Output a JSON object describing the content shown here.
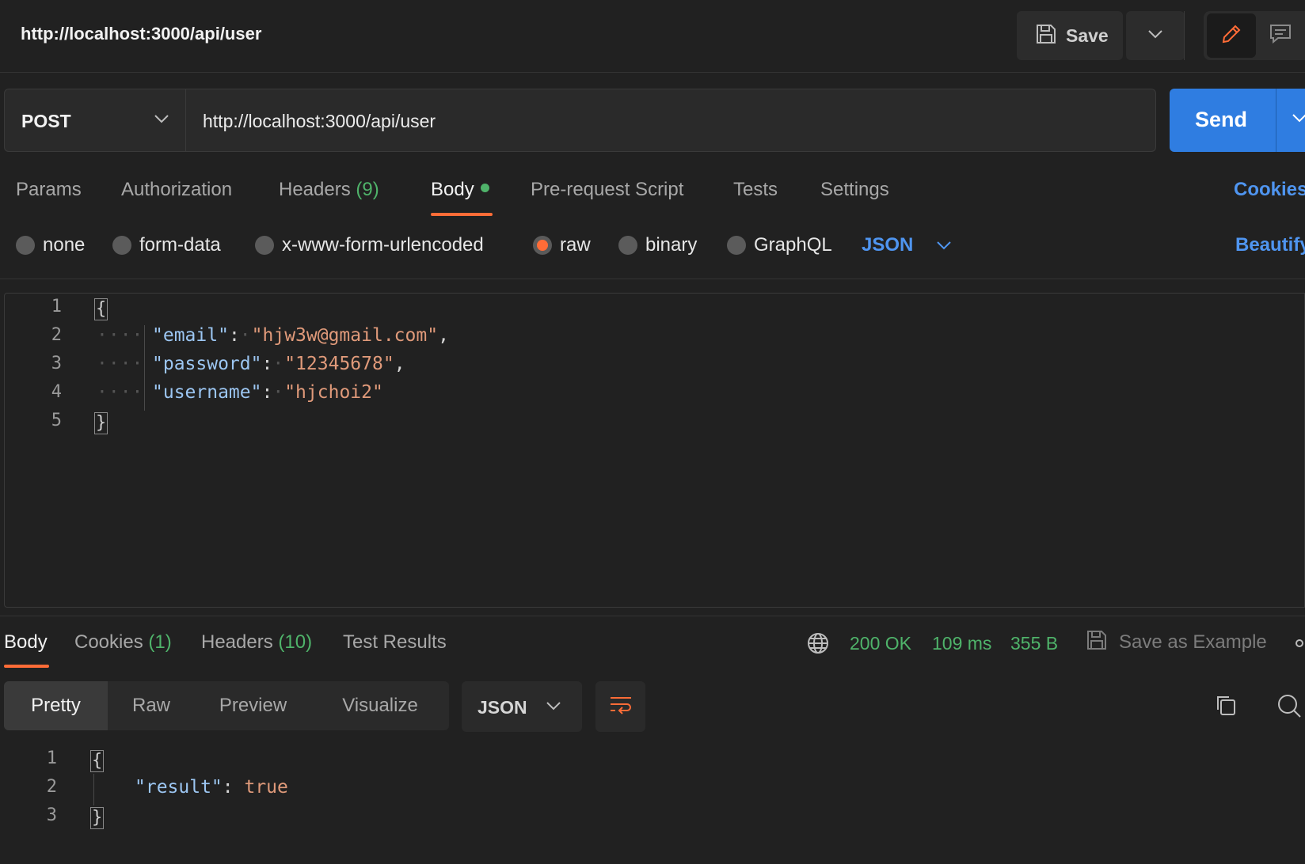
{
  "window": {
    "title": "http://localhost:3000/api/user",
    "save_label": "Save"
  },
  "request": {
    "method": "POST",
    "url": "http://localhost:3000/api/user",
    "send_label": "Send"
  },
  "request_tabs": {
    "params": "Params",
    "authorization": "Authorization",
    "headers": "Headers",
    "headers_count": "(9)",
    "body": "Body",
    "pre_request": "Pre-request Script",
    "tests": "Tests",
    "settings": "Settings",
    "cookies": "Cookies"
  },
  "body_types": {
    "none": "none",
    "form_data": "form-data",
    "urlencoded": "x-www-form-urlencoded",
    "raw": "raw",
    "binary": "binary",
    "graphql": "GraphQL",
    "selected": "raw",
    "language": "JSON",
    "beautify": "Beautify"
  },
  "request_body": {
    "line_numbers": [
      "1",
      "2",
      "3",
      "4",
      "5"
    ],
    "open_brace": "{",
    "close_brace": "}",
    "fields": [
      {
        "key": "\"email\"",
        "value": "\"hjw3w@gmail.com\"",
        "comma": ","
      },
      {
        "key": "\"password\"",
        "value": "\"12345678\"",
        "comma": ","
      },
      {
        "key": "\"username\"",
        "value": "\"hjchoi2\"",
        "comma": ""
      }
    ]
  },
  "response_tabs": {
    "body": "Body",
    "cookies": "Cookies",
    "cookies_count": "(1)",
    "headers": "Headers",
    "headers_count": "(10)",
    "test_results": "Test Results"
  },
  "response_meta": {
    "status": "200 OK",
    "time": "109 ms",
    "size": "355 B",
    "save_example": "Save as Example"
  },
  "view_modes": {
    "pretty": "Pretty",
    "raw": "Raw",
    "preview": "Preview",
    "visualize": "Visualize",
    "format": "JSON"
  },
  "response_body": {
    "line_numbers": [
      "1",
      "2",
      "3"
    ],
    "open_brace": "{",
    "close_brace": "}",
    "key": "\"result\"",
    "value": "true"
  },
  "colors": {
    "accent": "#ff6c37",
    "send": "#2f7de1",
    "link": "#4f95f0",
    "success": "#4fb36a",
    "json_key": "#9cc6f2",
    "json_string": "#e09a7a"
  }
}
